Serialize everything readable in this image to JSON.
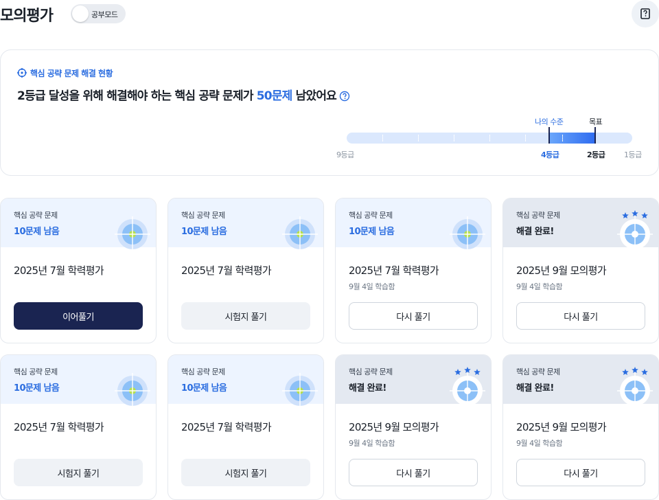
{
  "header": {
    "title": "모의평가",
    "mode_toggle_label": "공부모드",
    "note_icon": "notebook-icon"
  },
  "status": {
    "eyebrow": "핵심 공략 문제 해결 현황",
    "headline_prefix": "2등급 달성을 위해 해결해야 하는 핵심 공략 문제가 ",
    "headline_count": "50문제",
    "headline_suffix": " 남았어요",
    "gauge": {
      "current_caption": "나의 수준",
      "goal_caption": "목표",
      "left_grade": "9등급",
      "current_grade": "4등급",
      "goal_grade": "2등급",
      "right_grade": "1등급"
    }
  },
  "cards": [
    {
      "eyebrow": "핵심 공략 문제",
      "status": "10문제 남음",
      "done": false,
      "title": "2025년 7월 학력평가",
      "sub": "",
      "button": "이어풀기",
      "button_style": "primary"
    },
    {
      "eyebrow": "핵심 공략 문제",
      "status": "10문제 남음",
      "done": false,
      "title": "2025년 7월 학력평가",
      "sub": "",
      "button": "시험지 풀기",
      "button_style": "secondary"
    },
    {
      "eyebrow": "핵심 공략 문제",
      "status": "10문제 남음",
      "done": false,
      "title": "2025년 7월 학력평가",
      "sub": "9월 4일 학습함",
      "button": "다시 풀기",
      "button_style": "outline"
    },
    {
      "eyebrow": "핵심 공략 문제",
      "status": "해결 완료!",
      "done": true,
      "title": "2025년 9월 모의평가",
      "sub": "9월 4일 학습함",
      "button": "다시 풀기",
      "button_style": "outline"
    },
    {
      "eyebrow": "핵심 공략 문제",
      "status": "10문제 남음",
      "done": false,
      "title": "2025년 7월 학력평가",
      "sub": "",
      "button": "시험지 풀기",
      "button_style": "secondary"
    },
    {
      "eyebrow": "핵심 공략 문제",
      "status": "10문제 남음",
      "done": false,
      "title": "2025년 7월 학력평가",
      "sub": "",
      "button": "시험지 풀기",
      "button_style": "secondary"
    },
    {
      "eyebrow": "핵심 공략 문제",
      "status": "해결 완료!",
      "done": true,
      "title": "2025년 9월 모의평가",
      "sub": "9월 4일 학습함",
      "button": "다시 풀기",
      "button_style": "outline"
    },
    {
      "eyebrow": "핵심 공략 문제",
      "status": "해결 완료!",
      "done": true,
      "title": "2025년 9월 모의평가",
      "sub": "9월 4일 학습함",
      "button": "다시 풀기",
      "button_style": "outline"
    }
  ],
  "colors": {
    "accent": "#2b6de0",
    "navy": "#1a2451",
    "target_blue": "#8cc0f7",
    "target_green": "#b6e04c"
  }
}
